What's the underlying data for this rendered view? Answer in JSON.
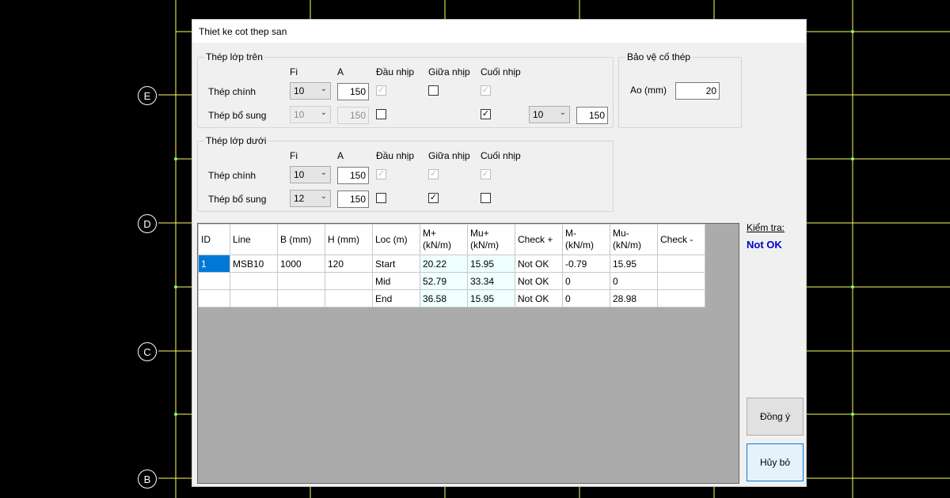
{
  "grid_labels": [
    "E",
    "D",
    "C",
    "B"
  ],
  "window": {
    "title": "Thiet ke cot thep san"
  },
  "top_steel": {
    "title": "Thép lớp trên",
    "col_fi": "Fi",
    "col_a": "A",
    "col_start": "Đầu nhịp",
    "col_mid": "Giữa nhịp",
    "col_end": "Cuối nhịp",
    "main": {
      "label": "Thép chính",
      "fi": "10",
      "a": "150",
      "start": true,
      "mid": false,
      "end": true
    },
    "extra": {
      "label": "Thép bổ sung",
      "fi": "10",
      "a": "150",
      "start": false,
      "end": true,
      "end_fi": "10",
      "end_a": "150"
    }
  },
  "cover": {
    "title": "Bảo vệ cố thép",
    "label": "Ao (mm)",
    "value": "20"
  },
  "bottom_steel": {
    "title": "Thép lớp dưới",
    "col_fi": "Fi",
    "col_a": "A",
    "col_start": "Đầu nhịp",
    "col_mid": "Giữa nhịp",
    "col_end": "Cuối nhịp",
    "main": {
      "label": "Thép chính",
      "fi": "10",
      "a": "150",
      "start": true,
      "mid": true,
      "end": true
    },
    "extra": {
      "label": "Thép bổ sung",
      "fi": "12",
      "a": "150",
      "start": false,
      "mid": true,
      "end": false
    }
  },
  "table": {
    "headers": [
      "ID",
      "Line",
      "B (mm)",
      "H (mm)",
      "Loc (m)",
      "M+ (kN/m)",
      "Mu+ (kN/m)",
      "Check +",
      "M- (kN/m)",
      "Mu- (kN/m)",
      "Check -"
    ],
    "rows": [
      [
        "1",
        "MSB10",
        "1000",
        "120",
        "Start",
        "20.22",
        "15.95",
        "Not OK",
        "-0.79",
        "15.95",
        ""
      ],
      [
        "",
        "",
        "",
        "",
        "Mid",
        "52.79",
        "33.34",
        "Not OK",
        "0",
        "0",
        ""
      ],
      [
        "",
        "",
        "",
        "",
        "End",
        "36.58",
        "15.95",
        "Not OK",
        "0",
        "28.98",
        ""
      ]
    ]
  },
  "check": {
    "label": "Kiểm tra:",
    "result": "Not OK",
    "result_color": "#0000cc"
  },
  "buttons": {
    "ok": "Đồng ý",
    "cancel": "Hủy bỏ"
  }
}
